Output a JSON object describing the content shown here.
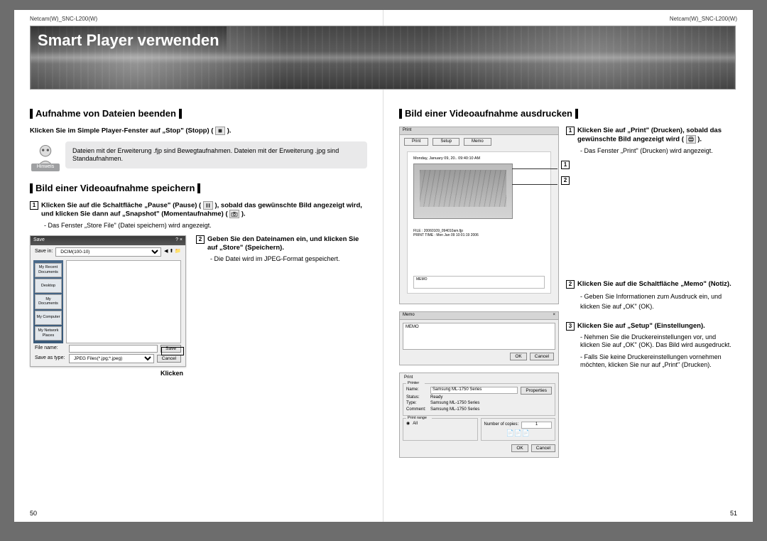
{
  "header_left": "Netcam(W)_SNC-L200(W)",
  "header_right": "Netcam(W)_SNC-L200(W)",
  "banner_title": "Smart Player verwenden",
  "page_num_left": "50",
  "page_num_right": "51",
  "left": {
    "sect1": "Aufnahme von Dateien beenden",
    "sect1_instr": "Klicken Sie im Simple Player-Fenster auf „Stop\" (Stopp) (",
    "sect1_instr_end": ").",
    "hinweis_label": "Hinweis",
    "hinweis_text": "Dateien mit der Erweiterung .fjp sind Bewegtaufnahmen. Dateien mit der Erweiterung .jpg sind Standaufnahmen.",
    "sect2": "Bild einer Videoaufnahme speichern",
    "step1": "Klicken Sie auf die Schaltfläche „Pause\" (Pause) (",
    "step1_mid": "), sobald das gewünschte Bild angezeigt wird, und klicken Sie dann auf „Snapshot\" (Momentaufnahme) (",
    "step1_end": ").",
    "step1_sub": "Das Fenster „Store File\" (Datei speichern) wird angezeigt.",
    "step2": "Geben Sie den Dateinamen ein, und klicken Sie auf „Store\" (Speichern).",
    "step2_sub": "Die Datei wird im JPEG-Format gespeichert.",
    "klicken": "Klicken",
    "save_dialog": {
      "title": "Save",
      "close": "? ×",
      "savein": "Save in:",
      "savein_value": "DCIM(100-10)",
      "slots": [
        "My Recent Documents",
        "Desktop",
        "My Documents",
        "My Computer",
        "My Network Places"
      ],
      "filename_label": "File name:",
      "filename_value": "",
      "saveas_label": "Save as type:",
      "saveas_value": "JPEG Files(*.jpg;*.jpeg)",
      "save_btn": "Save",
      "cancel_btn": "Cancel"
    }
  },
  "right": {
    "sect": "Bild einer Videoaufnahme ausdrucken",
    "step1": "Klicken Sie auf „Print\" (Drucken), sobald das gewünschte Bild angezeigt wird (",
    "step1_end": ").",
    "step1_sub": "Das Fenster „Print\" (Drucken) wird angezeigt.",
    "step2": "Klicken Sie auf die Schaltfläche „Memo\" (Notiz).",
    "step2_sub": "Geben Sie Informationen zum Ausdruck ein, und klicken Sie auf „OK\" (OK).",
    "step3": "Klicken Sie auf „Setup\" (Einstellungen).",
    "step3_sub1": "Nehmen Sie die Druckereinstellungen vor, und klicken Sie auf „OK\" (OK). Das Bild wird ausgedruckt.",
    "step3_sub2": "Falls Sie keine Druckereinstellungen vornehmen möchten, klicken Sie nur auf „Print\" (Drucken).",
    "print_dialog": {
      "title": "Print",
      "btns": [
        "Print",
        "Setup",
        "Memo"
      ],
      "timestamp": "Monday, January 09, 20..  09:40:10 AM",
      "file_line": "FILE : 20060109_094010am.fjp",
      "print_time": "PRINT TIME : Mon Jan 09 10:01:19 2006",
      "memo_label": "MEMO"
    },
    "memo_dialog": {
      "title": "Memo",
      "content": "MEMO",
      "ok": "OK",
      "cancel": "Cancel",
      "close": "×"
    },
    "setup_dialog": {
      "title": "Print",
      "printer_group": "Printer",
      "name_label": "Name:",
      "name_value": "Samsung ML-1750 Series",
      "properties": "Properties",
      "status_label": "Status:",
      "status_value": "Ready",
      "type_label": "Type:",
      "type_value": "Samsung ML-1750 Series",
      "comment_label": "Comment:",
      "comment_value": "Samsung ML-1750 Series",
      "print_range": "Print range",
      "all": "All",
      "copies": "Number of copies:",
      "copies_value": "1",
      "ok": "OK",
      "cancel": "Cancel"
    }
  }
}
